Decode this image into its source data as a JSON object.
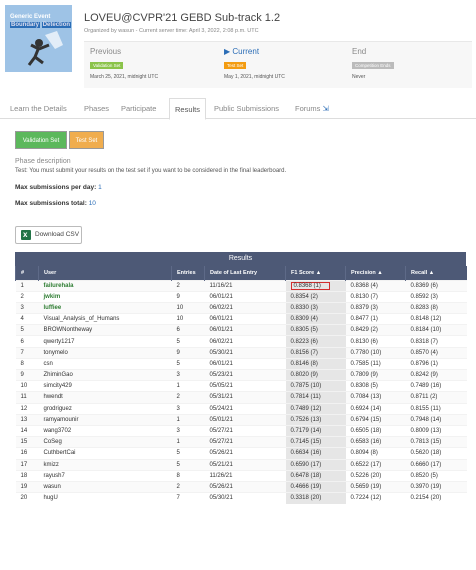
{
  "logo": {
    "line1": "Generic Event",
    "line2": "Boundary",
    "line3": "Detection"
  },
  "header": {
    "title": "LOVEU@CVPR'21 GEBD Sub-track 1.2",
    "organized": "Organized by wasun - Current server time: April 3, 2022, 2:08 p.m. UTC"
  },
  "phases": [
    {
      "name": "Previous",
      "label": "Validation Set",
      "date": "March 25, 2021, midnight UTC",
      "color": "#8bc34a"
    },
    {
      "name": "Current",
      "label": "Test Set",
      "date": "May 1, 2021, midnight UTC",
      "color": "#f39c12"
    },
    {
      "name": "End",
      "label": "Competition Ends",
      "date": "Never",
      "color": "#bbbbbb"
    }
  ],
  "tabs": [
    "Learn the Details",
    "Phases",
    "Participate",
    "Results",
    "Public Submissions",
    "Forums"
  ],
  "set_buttons": {
    "validation": "Validation Set",
    "test": "Test Set"
  },
  "phase_description": {
    "title": "Phase description",
    "text": "Test: You must submit your results on the test set if you want to be considered in the final leaderboard."
  },
  "max_per_day": {
    "label": "Max submissions per day:",
    "value": "1"
  },
  "max_total": {
    "label": "Max submissions total:",
    "value": "10"
  },
  "download_csv": "Download CSV",
  "results": {
    "title": "Results",
    "columns": [
      "#",
      "User",
      "Entries",
      "Date of Last Entry",
      "F1 Score ▲",
      "Precision ▲",
      "Recall ▲"
    ],
    "rows": [
      [
        "1",
        "failurehala",
        "2",
        "11/16/21",
        "0.8368 (1)",
        "0.8368 (4)",
        "0.8369 (6)"
      ],
      [
        "2",
        "jwkim",
        "9",
        "06/01/21",
        "0.8354 (2)",
        "0.8130 (7)",
        "0.8592 (3)"
      ],
      [
        "3",
        "luffiee",
        "10",
        "06/02/21",
        "0.8330 (3)",
        "0.8379 (3)",
        "0.8283 (8)"
      ],
      [
        "4",
        "Visual_Analysis_of_Humans",
        "10",
        "06/01/21",
        "0.8309 (4)",
        "0.8477 (1)",
        "0.8148 (12)"
      ],
      [
        "5",
        "BROWNontheway",
        "6",
        "06/01/21",
        "0.8305 (5)",
        "0.8429 (2)",
        "0.8184 (10)"
      ],
      [
        "6",
        "qwerty1217",
        "5",
        "06/02/21",
        "0.8223 (6)",
        "0.8130 (6)",
        "0.8318 (7)"
      ],
      [
        "7",
        "tonymelo",
        "9",
        "05/30/21",
        "0.8156 (7)",
        "0.7780 (10)",
        "0.8570 (4)"
      ],
      [
        "8",
        "csn",
        "5",
        "06/01/21",
        "0.8146 (8)",
        "0.7585 (11)",
        "0.8796 (1)"
      ],
      [
        "9",
        "ZhiminGao",
        "3",
        "05/23/21",
        "0.8020 (9)",
        "0.7809 (9)",
        "0.8242 (9)"
      ],
      [
        "10",
        "simcity429",
        "1",
        "05/05/21",
        "0.7875 (10)",
        "0.8308 (5)",
        "0.7489 (16)"
      ],
      [
        "11",
        "hwendt",
        "2",
        "05/31/21",
        "0.7814 (11)",
        "0.7084 (13)",
        "0.8711 (2)"
      ],
      [
        "12",
        "grodriguez",
        "3",
        "05/24/21",
        "0.7489 (12)",
        "0.6924 (14)",
        "0.8155 (11)"
      ],
      [
        "13",
        "ramyamounir",
        "1",
        "05/01/21",
        "0.7526 (13)",
        "0.6794 (15)",
        "0.7948 (14)"
      ],
      [
        "14",
        "wang3702",
        "3",
        "05/27/21",
        "0.7179 (14)",
        "0.6505 (18)",
        "0.8009 (13)"
      ],
      [
        "15",
        "CoSeg",
        "1",
        "05/27/21",
        "0.7145 (15)",
        "0.6583 (16)",
        "0.7813 (15)"
      ],
      [
        "16",
        "CuthbertCai",
        "5",
        "05/26/21",
        "0.6634 (16)",
        "0.8094 (8)",
        "0.5620 (18)"
      ],
      [
        "17",
        "kmizz",
        "5",
        "05/21/21",
        "0.6590 (17)",
        "0.6522 (17)",
        "0.6660 (17)"
      ],
      [
        "18",
        "rayush7",
        "8",
        "11/26/21",
        "0.6478 (18)",
        "0.5226 (20)",
        "0.8520 (5)"
      ],
      [
        "19",
        "wasun",
        "2",
        "05/26/21",
        "0.4666 (19)",
        "0.5659 (19)",
        "0.3970 (19)"
      ],
      [
        "20",
        "hugU",
        "7",
        "05/30/21",
        "0.3318 (20)",
        "0.7224 (12)",
        "0.2154 (20)"
      ]
    ]
  }
}
